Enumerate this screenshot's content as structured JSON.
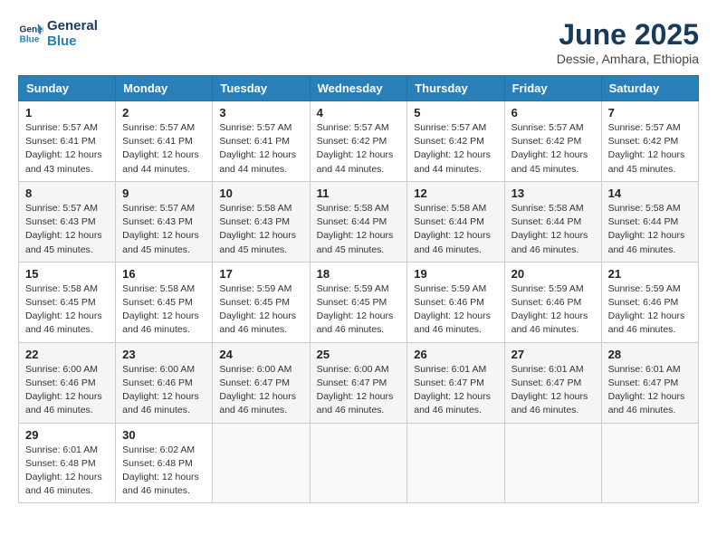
{
  "header": {
    "logo_line1": "General",
    "logo_line2": "Blue",
    "title": "June 2025",
    "subtitle": "Dessie, Amhara, Ethiopia"
  },
  "columns": [
    "Sunday",
    "Monday",
    "Tuesday",
    "Wednesday",
    "Thursday",
    "Friday",
    "Saturday"
  ],
  "weeks": [
    [
      {
        "day": "1",
        "info": "Sunrise: 5:57 AM\nSunset: 6:41 PM\nDaylight: 12 hours and 43 minutes."
      },
      {
        "day": "2",
        "info": "Sunrise: 5:57 AM\nSunset: 6:41 PM\nDaylight: 12 hours and 44 minutes."
      },
      {
        "day": "3",
        "info": "Sunrise: 5:57 AM\nSunset: 6:41 PM\nDaylight: 12 hours and 44 minutes."
      },
      {
        "day": "4",
        "info": "Sunrise: 5:57 AM\nSunset: 6:42 PM\nDaylight: 12 hours and 44 minutes."
      },
      {
        "day": "5",
        "info": "Sunrise: 5:57 AM\nSunset: 6:42 PM\nDaylight: 12 hours and 44 minutes."
      },
      {
        "day": "6",
        "info": "Sunrise: 5:57 AM\nSunset: 6:42 PM\nDaylight: 12 hours and 45 minutes."
      },
      {
        "day": "7",
        "info": "Sunrise: 5:57 AM\nSunset: 6:42 PM\nDaylight: 12 hours and 45 minutes."
      }
    ],
    [
      {
        "day": "8",
        "info": "Sunrise: 5:57 AM\nSunset: 6:43 PM\nDaylight: 12 hours and 45 minutes."
      },
      {
        "day": "9",
        "info": "Sunrise: 5:57 AM\nSunset: 6:43 PM\nDaylight: 12 hours and 45 minutes."
      },
      {
        "day": "10",
        "info": "Sunrise: 5:58 AM\nSunset: 6:43 PM\nDaylight: 12 hours and 45 minutes."
      },
      {
        "day": "11",
        "info": "Sunrise: 5:58 AM\nSunset: 6:44 PM\nDaylight: 12 hours and 45 minutes."
      },
      {
        "day": "12",
        "info": "Sunrise: 5:58 AM\nSunset: 6:44 PM\nDaylight: 12 hours and 46 minutes."
      },
      {
        "day": "13",
        "info": "Sunrise: 5:58 AM\nSunset: 6:44 PM\nDaylight: 12 hours and 46 minutes."
      },
      {
        "day": "14",
        "info": "Sunrise: 5:58 AM\nSunset: 6:44 PM\nDaylight: 12 hours and 46 minutes."
      }
    ],
    [
      {
        "day": "15",
        "info": "Sunrise: 5:58 AM\nSunset: 6:45 PM\nDaylight: 12 hours and 46 minutes."
      },
      {
        "day": "16",
        "info": "Sunrise: 5:58 AM\nSunset: 6:45 PM\nDaylight: 12 hours and 46 minutes."
      },
      {
        "day": "17",
        "info": "Sunrise: 5:59 AM\nSunset: 6:45 PM\nDaylight: 12 hours and 46 minutes."
      },
      {
        "day": "18",
        "info": "Sunrise: 5:59 AM\nSunset: 6:45 PM\nDaylight: 12 hours and 46 minutes."
      },
      {
        "day": "19",
        "info": "Sunrise: 5:59 AM\nSunset: 6:46 PM\nDaylight: 12 hours and 46 minutes."
      },
      {
        "day": "20",
        "info": "Sunrise: 5:59 AM\nSunset: 6:46 PM\nDaylight: 12 hours and 46 minutes."
      },
      {
        "day": "21",
        "info": "Sunrise: 5:59 AM\nSunset: 6:46 PM\nDaylight: 12 hours and 46 minutes."
      }
    ],
    [
      {
        "day": "22",
        "info": "Sunrise: 6:00 AM\nSunset: 6:46 PM\nDaylight: 12 hours and 46 minutes."
      },
      {
        "day": "23",
        "info": "Sunrise: 6:00 AM\nSunset: 6:46 PM\nDaylight: 12 hours and 46 minutes."
      },
      {
        "day": "24",
        "info": "Sunrise: 6:00 AM\nSunset: 6:47 PM\nDaylight: 12 hours and 46 minutes."
      },
      {
        "day": "25",
        "info": "Sunrise: 6:00 AM\nSunset: 6:47 PM\nDaylight: 12 hours and 46 minutes."
      },
      {
        "day": "26",
        "info": "Sunrise: 6:01 AM\nSunset: 6:47 PM\nDaylight: 12 hours and 46 minutes."
      },
      {
        "day": "27",
        "info": "Sunrise: 6:01 AM\nSunset: 6:47 PM\nDaylight: 12 hours and 46 minutes."
      },
      {
        "day": "28",
        "info": "Sunrise: 6:01 AM\nSunset: 6:47 PM\nDaylight: 12 hours and 46 minutes."
      }
    ],
    [
      {
        "day": "29",
        "info": "Sunrise: 6:01 AM\nSunset: 6:48 PM\nDaylight: 12 hours and 46 minutes."
      },
      {
        "day": "30",
        "info": "Sunrise: 6:02 AM\nSunset: 6:48 PM\nDaylight: 12 hours and 46 minutes."
      },
      {
        "day": "",
        "info": ""
      },
      {
        "day": "",
        "info": ""
      },
      {
        "day": "",
        "info": ""
      },
      {
        "day": "",
        "info": ""
      },
      {
        "day": "",
        "info": ""
      }
    ]
  ]
}
